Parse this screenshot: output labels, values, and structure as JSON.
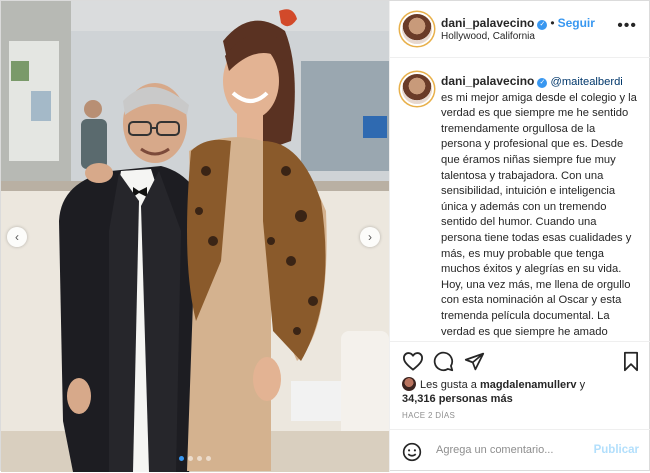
{
  "post": {
    "username": "dani_palavecino",
    "follow_label": "Seguir",
    "separator": "•",
    "location": "Hollywood, California",
    "more_glyph": "•••",
    "verified_glyph": "✓",
    "caption_mention": "@maitealberdi",
    "caption_text": " es mi mejor amiga desde el colegio y la verdad es que siempre me he sentido tremendamente orgullosa de la persona y profesional que es. Desde que éramos niñas siempre fue muy talentosa y trabajadora. Con una sensibilidad, intuición e inteligencia única y además con un tremendo sentido del humor. Cuando una persona tiene todas esas cualidades y más, es muy probable que tenga muchos éxitos y alegrías en su vida. Hoy, una vez más, me llena de orgullo con esta nominación al Oscar y esta tremenda película documental. La verdad es que siempre he amado todas sus películas y hoy, una vez más, se me",
    "likes_prefix": "Les gusta a ",
    "likes_user": "magdalenamullerv",
    "likes_mid": " y",
    "likes_count": "34,316 personas más",
    "timestamp": "HACE 2 DÍAS",
    "comment_placeholder": "Agrega un comentario...",
    "publish_label": "Publicar"
  },
  "carousel": {
    "prev_glyph": "‹",
    "next_glyph": "›",
    "slides": 4,
    "active_index": 0
  },
  "icons": {
    "like": "heart-icon",
    "comment": "comment-icon",
    "share": "paper-plane-icon",
    "save": "bookmark-icon",
    "emoji": "smiley-icon",
    "more": "more-options-icon",
    "verified": "verified-badge-icon"
  },
  "colors": {
    "accent": "#3897f0",
    "publish_disabled": "#b2dffc",
    "muted": "#8e8e8e",
    "mention": "#00376b"
  }
}
